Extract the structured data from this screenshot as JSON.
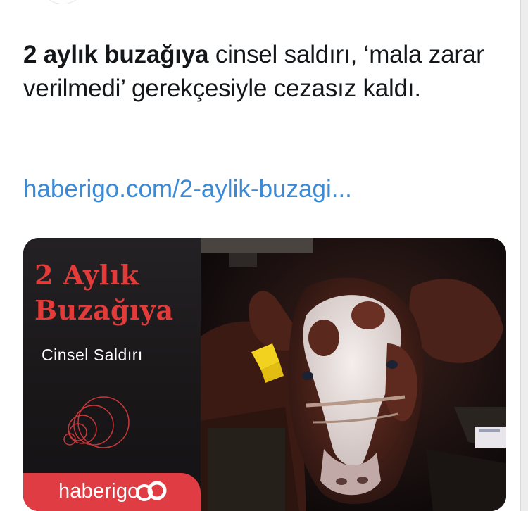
{
  "tweet": {
    "text_bold": "2 aylık buzağıya",
    "text_rest": " cinsel saldırı, ‘mala zarar verilmedi’ gerekçesiyle cezasız kaldı.",
    "link": "haberigo.com/2-aylik-buzagi..."
  },
  "card": {
    "headline_line1": "2 Aylık",
    "headline_line2": "Buzağıya",
    "subheadline": "Cinsel Saldırı",
    "brand": "haberigo",
    "image_description": "calf-photo"
  },
  "colors": {
    "link": "#3a8ad6",
    "headline_red": "#e33a3a",
    "brand_bar": "#e03c43",
    "text": "#14171a"
  }
}
